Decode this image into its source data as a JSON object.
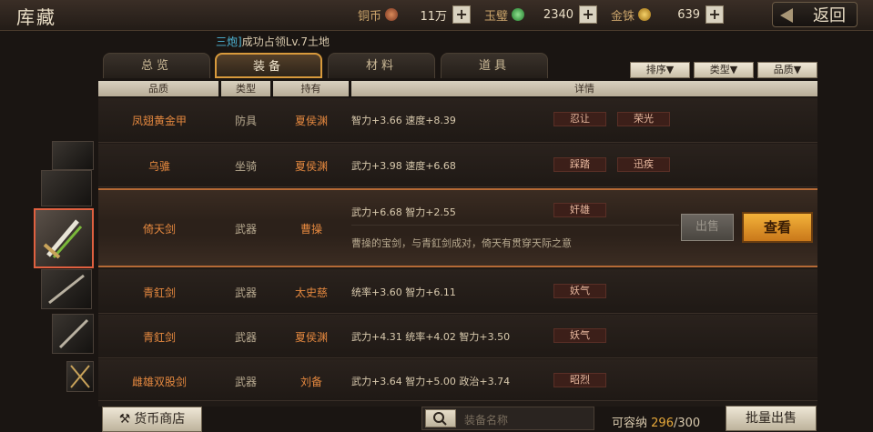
{
  "header": {
    "title": "库藏",
    "back_label": "返回",
    "currencies": [
      {
        "label": "铜币",
        "value": "11万",
        "color": "#b5633a"
      },
      {
        "label": "玉璧",
        "value": "2340",
        "color": "#4caf50"
      },
      {
        "label": "金铢",
        "value": "639",
        "color": "#d8a22a"
      }
    ]
  },
  "notice": {
    "tag": "三炮]",
    "text": "成功占领Lv.7土地"
  },
  "tabs": [
    "总览",
    "装备",
    "材料",
    "道具"
  ],
  "active_tab": 1,
  "sort_buttons": [
    "排序▼",
    "类型▼",
    "品质▼"
  ],
  "columns": [
    "品质",
    "类型",
    "持有",
    "详情"
  ],
  "rows": [
    {
      "name": "凤翅黄金甲",
      "type": "防具",
      "owner": "夏侯渊",
      "stats": "智力+3.66 速度+8.39",
      "traits": [
        "忍让",
        "荣光"
      ]
    },
    {
      "name": "乌骓",
      "type": "坐骑",
      "owner": "夏侯渊",
      "stats": "武力+3.98 速度+6.68",
      "traits": [
        "踩踏",
        "迅疾"
      ]
    },
    {
      "name": "倚天剑",
      "type": "武器",
      "owner": "曹操",
      "stats": "武力+6.68 智力+2.55",
      "traits": [
        "奸雄"
      ],
      "desc": "曹操的宝剑，与青釭剑成对，倚天有贯穿天际之意"
    },
    {
      "name": "青釭剑",
      "type": "武器",
      "owner": "太史慈",
      "stats": "统率+3.60 智力+6.11",
      "traits": [
        "妖气"
      ]
    },
    {
      "name": "青釭剑",
      "type": "武器",
      "owner": "夏侯渊",
      "stats": "武力+4.31 统率+4.02 智力+3.50",
      "traits": [
        "妖气"
      ]
    },
    {
      "name": "雌雄双股剑",
      "type": "武器",
      "owner": "刘备",
      "stats": "武力+3.64 智力+5.00 政治+3.74",
      "traits": [
        "昭烈"
      ]
    }
  ],
  "actions": {
    "sell": "出售",
    "view": "查看"
  },
  "bottom": {
    "shop_label": "货币商店",
    "search_placeholder": "装备名称",
    "capacity_label": "可容纳",
    "capacity_current": "296",
    "capacity_max": "/300",
    "bulk_sell": "批量出售"
  }
}
